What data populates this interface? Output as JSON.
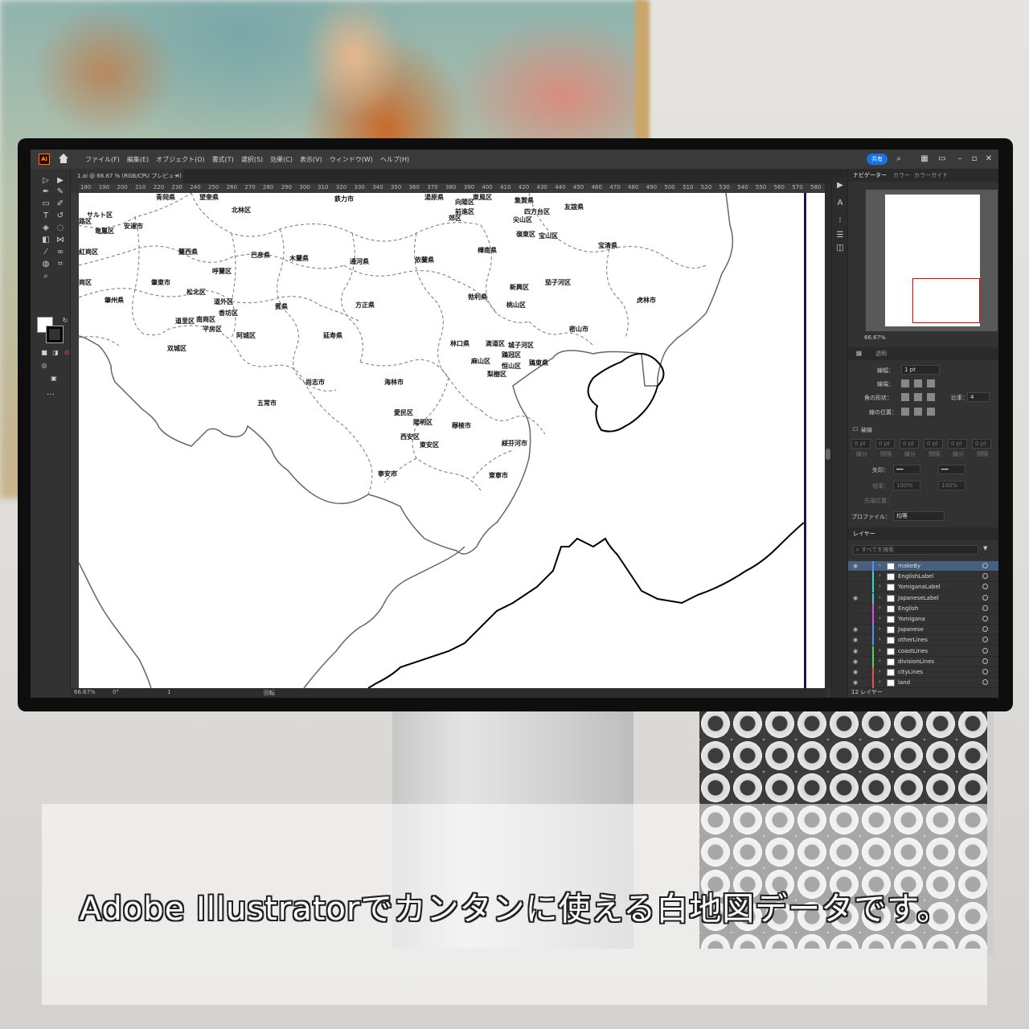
{
  "app": {
    "menu": [
      "ファイル(F)",
      "編集(E)",
      "オブジェクト(O)",
      "書式(T)",
      "選択(S)",
      "効果(C)",
      "表示(V)",
      "ウィンドウ(W)",
      "ヘルプ(H)"
    ],
    "share_label": "共有",
    "logo_text": "Ai"
  },
  "document": {
    "tab_label": "1.ai @ 66.67 % (RGB/CPU プレビュー)",
    "tab_close": "×"
  },
  "ruler": {
    "ticks": [
      "180",
      "190",
      "200",
      "210",
      "220",
      "230",
      "240",
      "250",
      "260",
      "270",
      "280",
      "290",
      "300",
      "310",
      "320",
      "330",
      "340",
      "350",
      "360",
      "370",
      "380",
      "390",
      "400",
      "410",
      "420",
      "430",
      "440",
      "450",
      "460",
      "470",
      "480",
      "490",
      "500",
      "510",
      "520",
      "530",
      "540",
      "550",
      "560",
      "570",
      "580"
    ]
  },
  "map": {
    "labels": [
      {
        "text": "青岡県"
      },
      {
        "text": "望奎県"
      },
      {
        "text": "鉄力市"
      },
      {
        "text": "湯原県"
      },
      {
        "text": "東風区"
      },
      {
        "text": "集賢県"
      },
      {
        "text": "向陽区"
      },
      {
        "text": "前進区"
      },
      {
        "text": "四方台区"
      },
      {
        "text": "友誼県"
      },
      {
        "text": "郊区"
      },
      {
        "text": "尖山区"
      },
      {
        "text": "嶺東区"
      },
      {
        "text": "宝山区"
      },
      {
        "text": "北林区"
      },
      {
        "text": "サルト区"
      },
      {
        "text": "竜鳳区"
      },
      {
        "text": "路区"
      },
      {
        "text": "安達市"
      },
      {
        "text": "紅崗区"
      },
      {
        "text": "蘭西県"
      },
      {
        "text": "巴彦県"
      },
      {
        "text": "木蘭県"
      },
      {
        "text": "通河県"
      },
      {
        "text": "依蘭県"
      },
      {
        "text": "樺南県"
      },
      {
        "text": "宝清県"
      },
      {
        "text": "呼蘭区"
      },
      {
        "text": "肇東市"
      },
      {
        "text": "崗区"
      },
      {
        "text": "松北区"
      },
      {
        "text": "新興区"
      },
      {
        "text": "茄子河区"
      },
      {
        "text": "肇州県"
      },
      {
        "text": "道外区"
      },
      {
        "text": "香坊区"
      },
      {
        "text": "賓県"
      },
      {
        "text": "方正県"
      },
      {
        "text": "勃利県"
      },
      {
        "text": "桃山区"
      },
      {
        "text": "虎林市"
      },
      {
        "text": "道里区"
      },
      {
        "text": "南崗区"
      },
      {
        "text": "平房区"
      },
      {
        "text": "阿城区"
      },
      {
        "text": "延寿県"
      },
      {
        "text": "密山市"
      },
      {
        "text": "双城区"
      },
      {
        "text": "林口県"
      },
      {
        "text": "滴道区"
      },
      {
        "text": "城子河区"
      },
      {
        "text": "鶏冠区"
      },
      {
        "text": "麻山区"
      },
      {
        "text": "恒山区"
      },
      {
        "text": "鶏東県"
      },
      {
        "text": "梨樹区"
      },
      {
        "text": "尚志市"
      },
      {
        "text": "海林市"
      },
      {
        "text": "五常市"
      },
      {
        "text": "愛民区"
      },
      {
        "text": "陽明区"
      },
      {
        "text": "穆棱市"
      },
      {
        "text": "西安区"
      },
      {
        "text": "綏芬河市"
      },
      {
        "text": "東安区"
      },
      {
        "text": "寧安市"
      },
      {
        "text": "東寧市"
      }
    ]
  },
  "status": {
    "zoom": "66.67%",
    "rotation": "0°",
    "artboard": "1",
    "mode": "回転"
  },
  "panels": {
    "top_tabs": [
      "ナビゲーター",
      "カラー",
      "カラーガイド"
    ],
    "nav_zoom": "66.67%",
    "stroke_tabs": [
      "線",
      "透明"
    ],
    "stroke_weight_label": "線幅：",
    "stroke_weight_value": "1 pt",
    "cap_label": "線端：",
    "join_label": "角の形状：",
    "miter_label": "比率：",
    "miter_value": "4",
    "align_label": "線の位置：",
    "dashed_label": "破線",
    "dash_values": [
      "0 pt",
      "0 pt",
      "0 pt",
      "0 pt",
      "0 pt",
      "0 pt"
    ],
    "dash_sublabels": [
      "線分",
      "間隔",
      "線分",
      "間隔",
      "線分",
      "間隔"
    ],
    "arrow_label": "矢印：",
    "scale_label": "倍率：",
    "scale_values": [
      "100%",
      "100%"
    ],
    "position_label": "先端位置：",
    "profile_label": "プロファイル：",
    "profile_value": "均等",
    "layers_tab": "レイヤー",
    "layers_search_placeholder": "すべてを検索",
    "layer_count": "12 レイヤー"
  },
  "layers": [
    {
      "name": "makeBy",
      "color": "#4f8ff7",
      "visible": true,
      "selected": true
    },
    {
      "name": "EnglishLabel",
      "color": "#3ecfcf",
      "visible": false
    },
    {
      "name": "YomiganaLabel",
      "color": "#3ecfcf",
      "visible": false
    },
    {
      "name": "JapaneseLabel",
      "color": "#3ecfcf",
      "visible": true
    },
    {
      "name": "English",
      "color": "#d84fd8",
      "visible": false
    },
    {
      "name": "Yomigana",
      "color": "#d84fd8",
      "visible": false
    },
    {
      "name": "Japanese",
      "color": "#4f8ff7",
      "visible": true
    },
    {
      "name": "otherLines",
      "color": "#4f8ff7",
      "visible": true
    },
    {
      "name": "coastLines",
      "color": "#4fd84f",
      "visible": true
    },
    {
      "name": "divisionLines",
      "color": "#4fd84f",
      "visible": true
    },
    {
      "name": "cityLines",
      "color": "#e84f4f",
      "visible": true
    },
    {
      "name": "land",
      "color": "#e84f4f",
      "visible": true
    }
  ],
  "caption": "Adobe Illustratorでカンタンに使える白地図データです。"
}
